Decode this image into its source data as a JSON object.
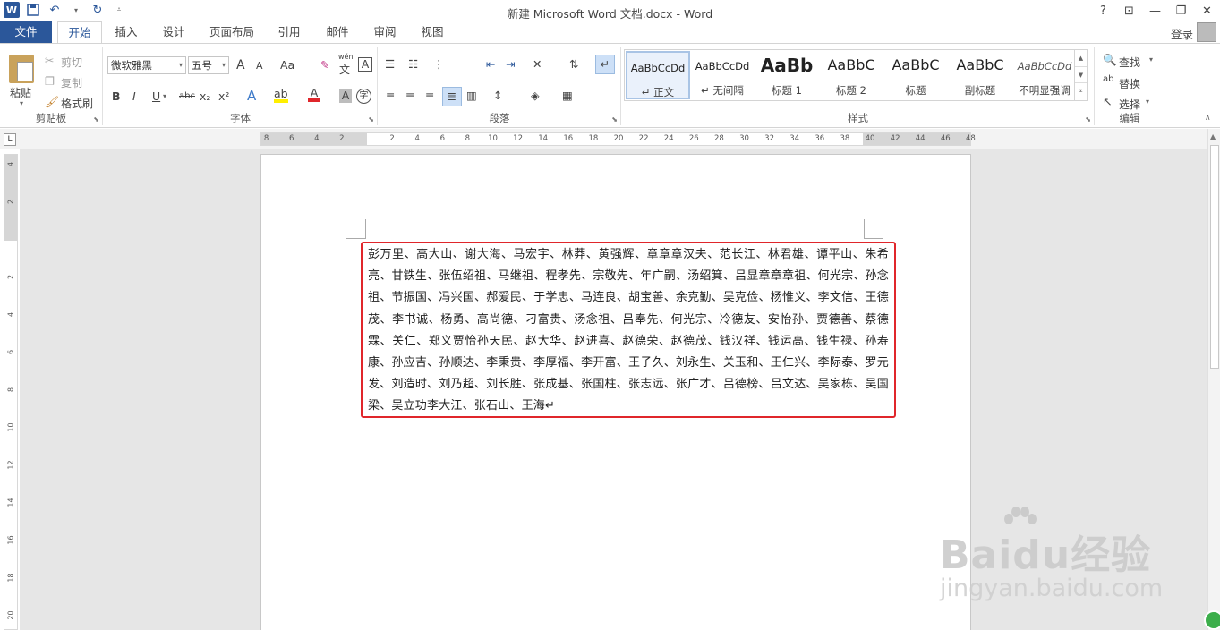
{
  "titlebar": {
    "title": "新建 Microsoft Word 文档.docx - Word",
    "help": "?",
    "ribbon_opts": "⊡",
    "minimize": "—",
    "restore": "❐",
    "close": "✕",
    "app_logo": "W"
  },
  "tabs": {
    "file": "文件",
    "home": "开始",
    "insert": "插入",
    "design": "设计",
    "layout": "页面布局",
    "references": "引用",
    "mailings": "邮件",
    "review": "审阅",
    "view": "视图",
    "login": "登录"
  },
  "clipboard": {
    "paste": "粘贴",
    "cut": "剪切",
    "copy": "复制",
    "format_painter": "格式刷",
    "label": "剪贴板"
  },
  "font": {
    "name": "微软雅黑",
    "size": "五号",
    "grow": "A",
    "shrink": "A",
    "case": "Aa",
    "wen": "wén",
    "wen_char": "文",
    "bold": "B",
    "italic": "I",
    "underline": "U",
    "strike": "abc",
    "sub": "x₂",
    "sup": "x²",
    "effects": "A",
    "highlight": "ab",
    "color": "A",
    "shade": "A",
    "enclose": "字",
    "label": "字体"
  },
  "paragraph": {
    "label": "段落"
  },
  "styles": {
    "label": "样式",
    "items": [
      {
        "preview": "AaBbCcDd",
        "name": "正文"
      },
      {
        "preview": "AaBbCcDd",
        "name": "无间隔"
      },
      {
        "preview": "AaBb",
        "name": "标题 1"
      },
      {
        "preview": "AaBbC",
        "name": "标题 2"
      },
      {
        "preview": "AaBbC",
        "name": "标题"
      },
      {
        "preview": "AaBbC",
        "name": "副标题"
      },
      {
        "preview": "AaBbCcDd",
        "name": "不明显强调"
      }
    ]
  },
  "editing": {
    "find": "查找",
    "replace": "替换",
    "select": "选择",
    "label": "编辑"
  },
  "ruler": {
    "corner": "L",
    "hticks": [
      "8",
      "6",
      "4",
      "2",
      "2",
      "4",
      "6",
      "8",
      "10",
      "12",
      "14",
      "16",
      "18",
      "20",
      "22",
      "24",
      "26",
      "28",
      "30",
      "32",
      "34",
      "36",
      "38",
      "40",
      "42",
      "44",
      "46",
      "48"
    ],
    "vticks": [
      "4",
      "2",
      "2",
      "4",
      "6",
      "8",
      "10",
      "12",
      "14",
      "16",
      "18",
      "20"
    ]
  },
  "document": {
    "paragraph": "彭万里、高大山、谢大海、马宏宇、林莽、黄强辉、章章章汉夫、范长江、林君雄、谭平山、朱希亮、甘铁生、张伍绍祖、马继祖、程孝先、宗敬先、年广嗣、汤绍箕、吕显章章章祖、何光宗、孙念祖、节振国、冯兴国、郝爱民、于学忠、马连良、胡宝善、余克勤、吴克俭、杨惟义、李文信、王德茂、李书诚、杨勇、高尚德、刁富贵、汤念祖、吕奉先、何光宗、冷德友、安怡孙、贾德善、蔡德霖、关仁、郑义贾怡孙天民、赵大华、赵进喜、赵德荣、赵德茂、钱汉祥、钱运高、钱生禄、孙寿康、孙应吉、孙顺达、李秉贵、李厚福、李开富、王子久、刘永生、关玉和、王仁兴、李际泰、罗元发、刘造时、刘乃超、刘长胜、张成基、张国柱、张志远、张广才、吕德榜、吕文达、吴家栋、吴国梁、吴立功李大江、张石山、王海↵"
  },
  "watermark": {
    "main": "Baidu经验",
    "sub": "jingyan.baidu.com"
  },
  "colors": {
    "word_blue": "#2b579a",
    "highlight_border": "#e0262b"
  }
}
